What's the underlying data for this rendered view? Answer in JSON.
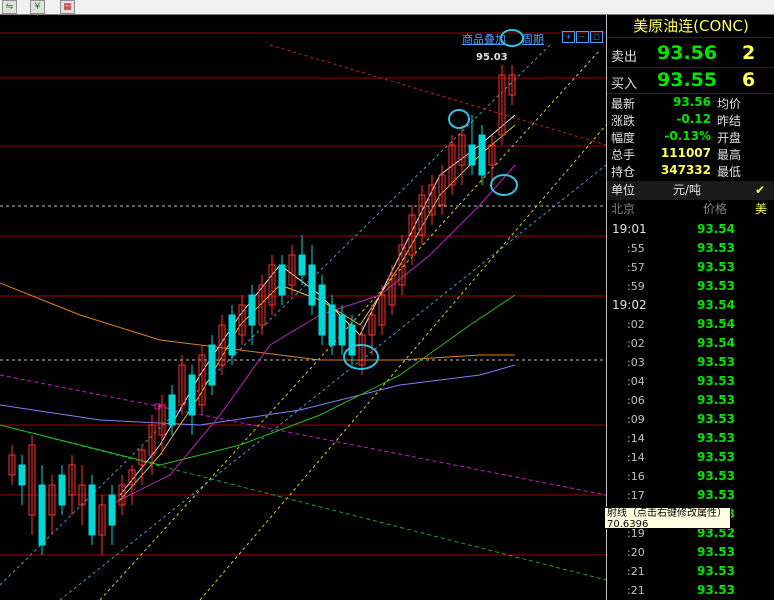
{
  "toolbar": {
    "icons": [
      "chart-toggle-icon",
      "info-icon",
      "grid-icon"
    ]
  },
  "chart": {
    "links": [
      "商品叠加",
      "周期"
    ],
    "price_label": "95.03",
    "chart_data": {
      "type": "candlestick",
      "title": "",
      "xlabel": "",
      "ylabel": ""
    }
  },
  "panel": {
    "title": "美原油连(CONC)",
    "sell": {
      "label": "卖出",
      "price": "93.56",
      "volume": "2"
    },
    "buy": {
      "label": "买入",
      "price": "93.55",
      "volume": "6"
    },
    "stats": [
      {
        "label": "最新",
        "value": "93.56",
        "color": "#00e600",
        "right": "均价"
      },
      {
        "label": "涨跌",
        "value": "-0.12",
        "color": "#00e600",
        "right": "昨结"
      },
      {
        "label": "幅度",
        "value": "-0.13%",
        "color": "#00e600",
        "right": "开盘"
      },
      {
        "label": "总手",
        "value": "111007",
        "color": "#ffff54",
        "right": "最高"
      },
      {
        "label": "持仓",
        "value": "347332",
        "color": "#ffff54",
        "right": "最低"
      }
    ],
    "unit_label": "单位",
    "unit_value": "元/吨",
    "unit_check": "✔ 美",
    "tick_headers": {
      "time": "北京",
      "price": "价格"
    },
    "ticks": [
      {
        "time": "19:01",
        "price": "93.54",
        "major": true
      },
      {
        "time": ":55",
        "price": "93.53",
        "major": false
      },
      {
        "time": ":57",
        "price": "93.53",
        "major": false
      },
      {
        "time": ":59",
        "price": "93.53",
        "major": false
      },
      {
        "time": "19:02",
        "price": "93.54",
        "major": true
      },
      {
        "time": ":02",
        "price": "93.54",
        "major": false
      },
      {
        "time": ":02",
        "price": "93.54",
        "major": false
      },
      {
        "time": ":03",
        "price": "93.53",
        "major": false
      },
      {
        "time": ":04",
        "price": "93.53",
        "major": false
      },
      {
        "time": ":06",
        "price": "93.53",
        "major": false
      },
      {
        "time": ":09",
        "price": "93.53",
        "major": false
      },
      {
        "time": ":14",
        "price": "93.53",
        "major": false
      },
      {
        "time": ":14",
        "price": "93.53",
        "major": false
      },
      {
        "time": ":16",
        "price": "93.53",
        "major": false
      },
      {
        "time": ":17",
        "price": "93.53",
        "major": false
      },
      {
        "time": ":17",
        "price": "93.53",
        "major": false
      },
      {
        "time": ":19",
        "price": "93.52",
        "major": false
      },
      {
        "time": ":20",
        "price": "93.53",
        "major": false
      },
      {
        "time": ":21",
        "price": "93.53",
        "major": false
      },
      {
        "time": ":21",
        "price": "93.53",
        "major": false
      }
    ]
  },
  "tooltip": {
    "line1": "射线（点击右键修改属性）",
    "line2": "70.6396"
  }
}
